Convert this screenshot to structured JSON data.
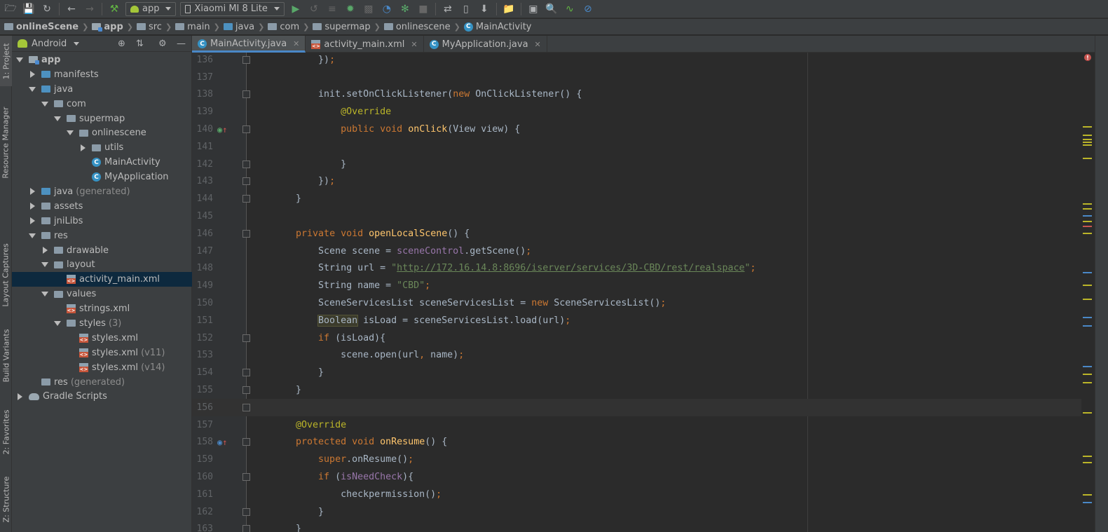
{
  "toolbar": {
    "icons": [
      "open-folder-icon",
      "save-icon",
      "sync-icon",
      "back-icon",
      "forward-icon",
      "hammer-icon",
      "run-icon",
      "apply-changes-icon",
      "profile-icon",
      "debug-icon",
      "attach-debugger-icon",
      "stop-icon",
      "gradle-sync-icon",
      "avd-manager-icon",
      "sdk-manager-icon",
      "project-structure-icon",
      "layout-inspector-icon",
      "search-icon",
      "profiler-icon",
      "disable-icon"
    ],
    "config_label": "app",
    "device_label": "Xiaomi MI 8 Lite"
  },
  "breadcrumb": [
    "onlineScene",
    "app",
    "src",
    "main",
    "java",
    "com",
    "supermap",
    "onlinescene",
    "MainActivity"
  ],
  "left_stripe": {
    "tabs": [
      "1: Project",
      "Resource Manager",
      "Layout Captures",
      "Build Variants",
      "2: Favorites",
      "Z: Structure"
    ]
  },
  "project_panel": {
    "view_label": "Android",
    "tree": [
      {
        "label": "app",
        "depth": 0,
        "state": "open",
        "icon": "module",
        "strong": true
      },
      {
        "label": "manifests",
        "depth": 1,
        "state": "closed",
        "icon": "folder-blue"
      },
      {
        "label": "java",
        "depth": 1,
        "state": "open",
        "icon": "folder-blue"
      },
      {
        "label": "com",
        "depth": 2,
        "state": "open",
        "icon": "package"
      },
      {
        "label": "supermap",
        "depth": 3,
        "state": "open",
        "icon": "package"
      },
      {
        "label": "onlinescene",
        "depth": 4,
        "state": "open",
        "icon": "package"
      },
      {
        "label": "utils",
        "depth": 5,
        "state": "closed",
        "icon": "package"
      },
      {
        "label": "MainActivity",
        "depth": 5,
        "state": "leaf",
        "icon": "class"
      },
      {
        "label": "MyApplication",
        "depth": 5,
        "state": "leaf",
        "icon": "class"
      },
      {
        "label": "java",
        "suffix": "(generated)",
        "depth": 1,
        "state": "closed",
        "icon": "folder-blue"
      },
      {
        "label": "assets",
        "depth": 1,
        "state": "closed",
        "icon": "folder"
      },
      {
        "label": "jniLibs",
        "depth": 1,
        "state": "closed",
        "icon": "folder"
      },
      {
        "label": "res",
        "depth": 1,
        "state": "open",
        "icon": "folder"
      },
      {
        "label": "drawable",
        "depth": 2,
        "state": "closed",
        "icon": "folder"
      },
      {
        "label": "layout",
        "depth": 2,
        "state": "open",
        "icon": "folder"
      },
      {
        "label": "activity_main.xml",
        "depth": 3,
        "state": "leaf",
        "icon": "xml",
        "selected": true
      },
      {
        "label": "values",
        "depth": 2,
        "state": "open",
        "icon": "folder"
      },
      {
        "label": "strings.xml",
        "depth": 3,
        "state": "leaf",
        "icon": "xml"
      },
      {
        "label": "styles",
        "suffix": "(3)",
        "depth": 3,
        "state": "open",
        "icon": "folder"
      },
      {
        "label": "styles.xml",
        "depth": 4,
        "state": "leaf",
        "icon": "xml"
      },
      {
        "label": "styles.xml",
        "suffix": "(v11)",
        "depth": 4,
        "state": "leaf",
        "icon": "xml"
      },
      {
        "label": "styles.xml",
        "suffix": "(v14)",
        "depth": 4,
        "state": "leaf",
        "icon": "xml"
      },
      {
        "label": "res",
        "suffix": "(generated)",
        "depth": 1,
        "state": "leaf",
        "icon": "folder"
      },
      {
        "label": "Gradle Scripts",
        "depth": 0,
        "state": "closed",
        "icon": "gradle"
      }
    ]
  },
  "editor_tabs": [
    {
      "label": "MainActivity.java",
      "icon": "class",
      "active": true
    },
    {
      "label": "activity_main.xml",
      "icon": "xml",
      "active": false
    },
    {
      "label": "MyApplication.java",
      "icon": "class",
      "active": false
    }
  ],
  "code": {
    "current_line": 156,
    "lines": [
      {
        "n": "136",
        "text": "        });"
      },
      {
        "n": "137",
        "text": ""
      },
      {
        "n": "138",
        "text": "        init.setOnClickListener(new OnClickListener() {"
      },
      {
        "n": "139",
        "text": "            @Override"
      },
      {
        "n": "140",
        "text": "            public void onClick(View view) {"
      },
      {
        "n": "141",
        "text": ""
      },
      {
        "n": "142",
        "text": "            }"
      },
      {
        "n": "143",
        "text": "        });"
      },
      {
        "n": "144",
        "text": "    }"
      },
      {
        "n": "145",
        "text": ""
      },
      {
        "n": "146",
        "text": "    private void openLocalScene() {"
      },
      {
        "n": "147",
        "text": "        Scene scene = sceneControl.getScene();"
      },
      {
        "n": "148",
        "text": "        String url = \"http://172.16.14.8:8696/iserver/services/3D-CBD/rest/realspace\";"
      },
      {
        "n": "149",
        "text": "        String name = \"CBD\";"
      },
      {
        "n": "150",
        "text": "        SceneServicesList sceneServicesList = new SceneServicesList();"
      },
      {
        "n": "151",
        "text": "        Boolean isLoad = sceneServicesList.load(url);"
      },
      {
        "n": "152",
        "text": "        if (isLoad){"
      },
      {
        "n": "153",
        "text": "            scene.open(url, name);"
      },
      {
        "n": "154",
        "text": "        }"
      },
      {
        "n": "155",
        "text": "    }"
      },
      {
        "n": "156",
        "text": ""
      },
      {
        "n": "157",
        "text": "    @Override"
      },
      {
        "n": "158",
        "text": "    protected void onResume() {"
      },
      {
        "n": "159",
        "text": "        super.onResume();"
      },
      {
        "n": "160",
        "text": "        if (isNeedCheck){"
      },
      {
        "n": "161",
        "text": "            checkpermission();"
      },
      {
        "n": "162",
        "text": "        }"
      },
      {
        "n": "163",
        "text": "    }"
      }
    ]
  },
  "colors": {
    "keyword": "#cc7832",
    "annotation": "#bbb529",
    "method": "#ffc66d",
    "string": "#6a8759",
    "field": "#9876aa",
    "plain": "#a9b7c6",
    "selection": "#0d293e",
    "active_tab_underline": "#4a88c7"
  }
}
